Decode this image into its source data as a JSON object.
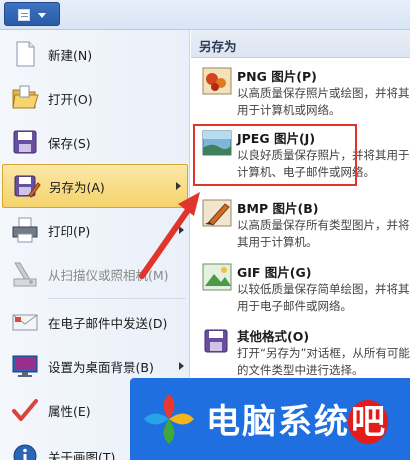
{
  "left_menu": {
    "items": [
      {
        "label": "新建(N)",
        "icon": "new-document-icon"
      },
      {
        "label": "打开(O)",
        "icon": "open-folder-icon"
      },
      {
        "label": "保存(S)",
        "icon": "save-icon"
      },
      {
        "label": "另存为(A)",
        "icon": "save-as-icon"
      },
      {
        "label": "打印(P)",
        "icon": "printer-icon"
      },
      {
        "label": "从扫描仪或照相机(M)",
        "icon": "scanner-icon"
      },
      {
        "label": "在电子邮件中发送(D)",
        "icon": "email-icon"
      },
      {
        "label": "设置为桌面背景(B)",
        "icon": "desktop-background-icon"
      },
      {
        "label": "属性(E)",
        "icon": "checkmark-icon"
      },
      {
        "label": "关于画图(T)",
        "icon": "info-icon"
      }
    ]
  },
  "save_as_panel": {
    "title": "另存为",
    "options": [
      {
        "title": "PNG 图片(P)",
        "desc": "以高质量保存照片或绘图，并将其用于计算机或网络。",
        "icon": "png-image-icon"
      },
      {
        "title": "JPEG 图片(J)",
        "desc": "以良好质量保存照片，并将其用于计算机、电子邮件或网络。",
        "icon": "jpeg-image-icon"
      },
      {
        "title": "BMP 图片(B)",
        "desc": "以高质量保存所有类型图片，并将其用于计算机。",
        "icon": "bmp-image-icon"
      },
      {
        "title": "GIF 图片(G)",
        "desc": "以较低质量保存简单绘图，并将其用于电子邮件或网络。",
        "icon": "gif-image-icon"
      },
      {
        "title": "其他格式(O)",
        "desc": "打开“另存为”对话框，从所有可能的文件类型中进行选择。",
        "icon": "other-formats-icon"
      }
    ]
  },
  "watermark": {
    "text_main": "电脑系统",
    "text_last": "吧"
  },
  "colors": {
    "highlight": "#e0352b",
    "active_item": "#f5d36c",
    "logo_bg": "#1f6fe0"
  }
}
